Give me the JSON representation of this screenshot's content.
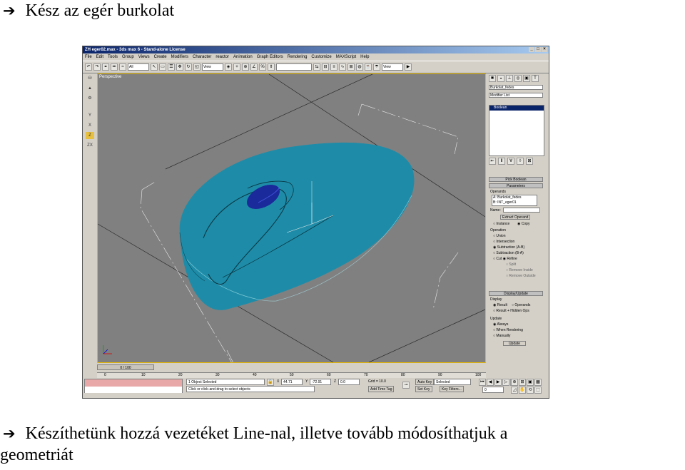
{
  "heading": {
    "arrow": "➔",
    "text": "Kész az egér burkolat"
  },
  "paragraph": {
    "arrow": "➔",
    "line1": "Készíthetünk hozzá vezetéket Line-nal, illetve tovább módosíthatjuk a",
    "line2": "geometriát"
  },
  "screenshot": {
    "title": "ZH eger02.max - 3ds max 6 - Stand-alone License",
    "menu": [
      "File",
      "Edit",
      "Tools",
      "Group",
      "Views",
      "Create",
      "Modifiers",
      "Character",
      "reactor",
      "Animation",
      "Graph Editors",
      "Rendering",
      "Customize",
      "MAXScript",
      "Help"
    ],
    "toolbar": {
      "filter": "All",
      "ref_coord": "View",
      "named_sel": "",
      "view2": "View"
    },
    "left_tools": [
      "Y",
      "X",
      "Z",
      "ZX"
    ],
    "viewport_label": "Perspective",
    "command_panel": {
      "object_name": "Burkolat_fedes",
      "modifier_list": "Modifier List",
      "stack_item": "Boolean",
      "rollout_pick": "Pick Boolean",
      "rollout_params": "Parameters",
      "operands_label": "Operands",
      "operand_a": "A: Burkolat_fedes",
      "operand_b": "B: INT_eger01",
      "name_label": "Name:",
      "extract_btn": "Extract Operand",
      "instance": "Instance",
      "copy": "Copy",
      "operation_label": "Operation",
      "op_union": "Union",
      "op_intersection": "Intersection",
      "op_sub_ab": "Subtraction (A-B)",
      "op_sub_ba": "Subtraction (B-A)",
      "op_cut": "Cut",
      "op_refine": "Refine",
      "op_split": "Split",
      "op_remove_inside": "Remove Inside",
      "op_remove_outside": "Remove Outside",
      "rollout_display": "Display/Update",
      "display_label": "Display",
      "disp_result": "Result",
      "disp_operands": "Operands",
      "disp_hidden": "Result + Hidden Ops",
      "update_label": "Update",
      "upd_always": "Always",
      "upd_rendering": "When Rendering",
      "upd_manually": "Manually",
      "update_btn": "Update"
    },
    "time_slider": "0 / 100",
    "ruler_ticks": [
      "0",
      "10",
      "20",
      "30",
      "40",
      "50",
      "60",
      "70",
      "80",
      "90",
      "100"
    ],
    "status": {
      "selected": "1 Object Selected",
      "prompt": "Click or click-and-drag to select objects",
      "x_label": "X",
      "x_val": "44.71",
      "y_label": "Y",
      "y_val": "-72.91",
      "z_label": "Z",
      "z_val": "0.0",
      "grid": "Grid = 10.0",
      "add_time_tag": "Add Time Tag",
      "auto_key": "Auto Key",
      "selected_dd": "Selected",
      "set_key": "Set Key",
      "key_filters": "Key Filters...",
      "frame": "0"
    },
    "colors": {
      "mouse_body": "#1e8ca8",
      "mouse_wheel": "#1a2a9a",
      "viewport_bg": "#808080",
      "title_blue": "#0a246a"
    }
  }
}
